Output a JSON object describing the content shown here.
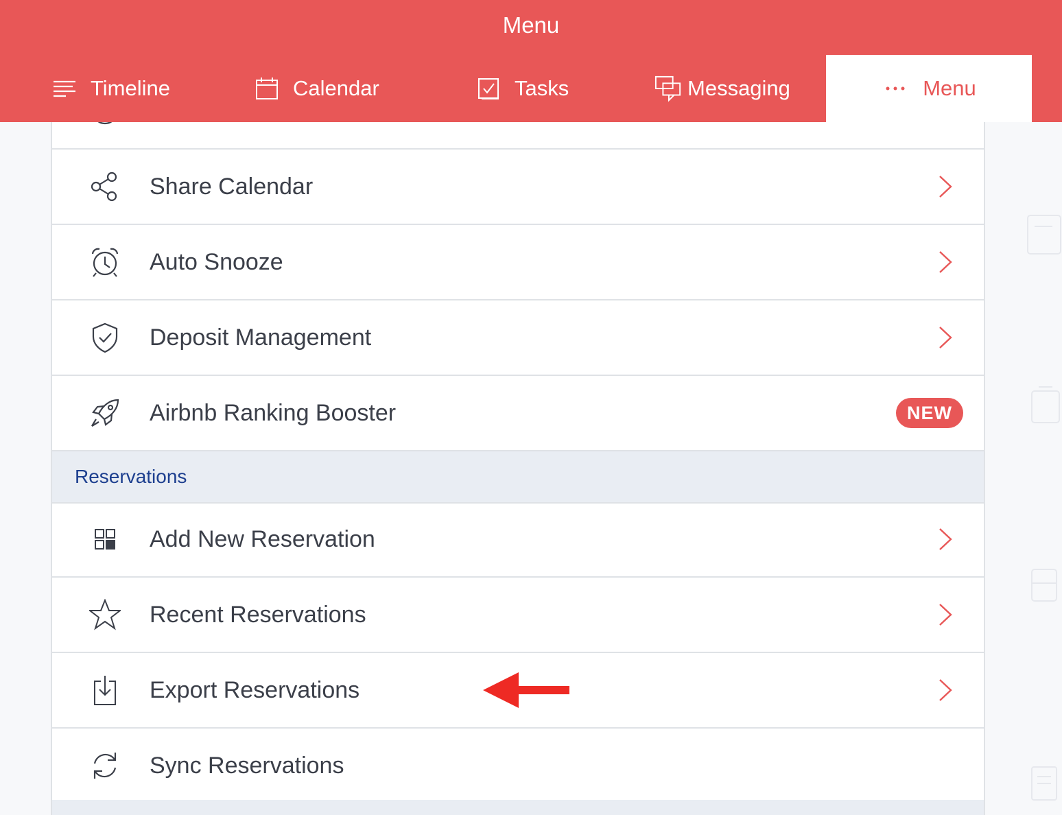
{
  "header": {
    "title": "Menu"
  },
  "tabs": [
    {
      "label": "Timeline",
      "icon": "timeline-icon"
    },
    {
      "label": "Calendar",
      "icon": "calendar-icon"
    },
    {
      "label": "Tasks",
      "icon": "tasks-icon"
    },
    {
      "label": "Messaging",
      "icon": "messaging-icon"
    },
    {
      "label": "Menu",
      "icon": "more-dots-icon",
      "active": true
    }
  ],
  "menu_items": [
    {
      "label": "Share Calendar",
      "icon": "share-icon"
    },
    {
      "label": "Auto Snooze",
      "icon": "alarm-clock-icon"
    },
    {
      "label": "Deposit Management",
      "icon": "shield-check-icon"
    },
    {
      "label": "Airbnb Ranking Booster",
      "icon": "rocket-icon",
      "badge": "NEW"
    }
  ],
  "reservations_section": {
    "title": "Reservations",
    "items": [
      {
        "label": "Add New Reservation",
        "icon": "grid-add-icon"
      },
      {
        "label": "Recent Reservations",
        "icon": "star-icon"
      },
      {
        "label": "Export Reservations",
        "icon": "export-icon"
      },
      {
        "label": "Sync Reservations",
        "icon": "sync-icon"
      }
    ]
  },
  "colors": {
    "accent": "#e85757",
    "section_text": "#1d3f8f",
    "section_bg": "#e9edf3",
    "annotation_arrow": "#ee2a24"
  }
}
